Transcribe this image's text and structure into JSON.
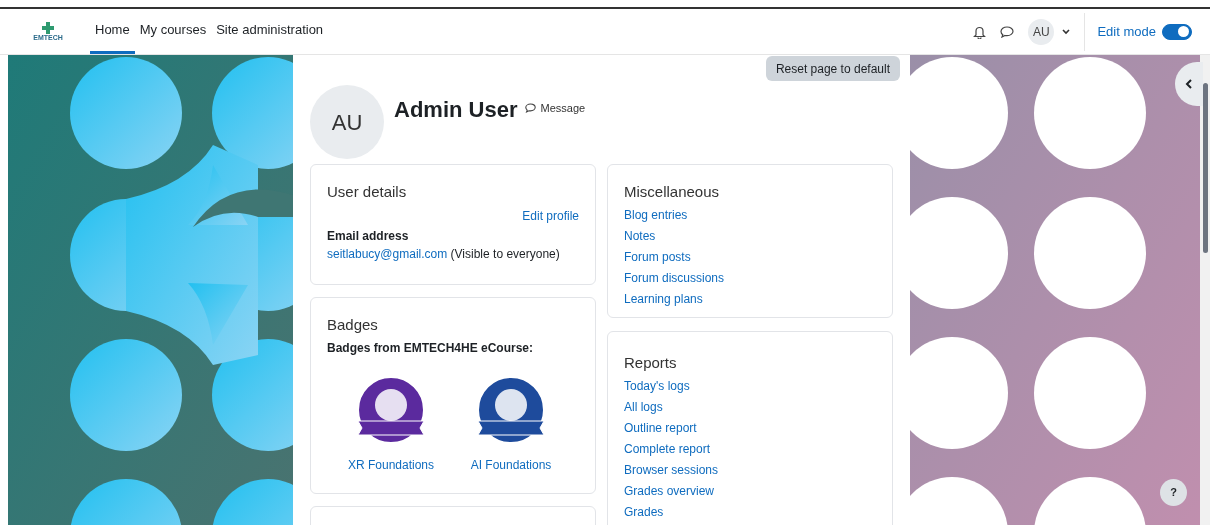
{
  "navbar": {
    "logo_text": "EMTECH",
    "items": [
      {
        "label": "Home",
        "selected": true
      },
      {
        "label": "My courses",
        "selected": false
      },
      {
        "label": "Site administration",
        "selected": false
      }
    ],
    "user_initials": "AU",
    "edit_mode": {
      "label": "Edit mode",
      "on": true
    }
  },
  "reset_button": "Reset page to default",
  "profile": {
    "initials": "AU",
    "name": "Admin User",
    "message_label": "Message"
  },
  "user_details": {
    "title": "User details",
    "edit_link": "Edit profile",
    "email_label": "Email address",
    "email": "seitlabucy@gmail.com",
    "visibility": "(Visible to everyone)"
  },
  "badges": {
    "title": "Badges",
    "subtitle": "Badges from EMTECH4HE eCourse:",
    "items": [
      {
        "name": "XR Foundations",
        "color": "#5b2a9e"
      },
      {
        "name": "AI Foundations",
        "color": "#1e4b9c"
      }
    ]
  },
  "miscellaneous": {
    "title": "Miscellaneous",
    "links": [
      "Blog entries",
      "Notes",
      "Forum posts",
      "Forum discussions",
      "Learning plans"
    ]
  },
  "reports": {
    "title": "Reports",
    "links": [
      "Today's logs",
      "All logs",
      "Outline report",
      "Complete report",
      "Browser sessions",
      "Grades overview",
      "Grades"
    ]
  },
  "help_button": "?"
}
